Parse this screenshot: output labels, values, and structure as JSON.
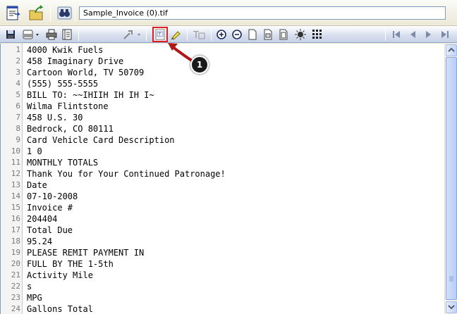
{
  "top_toolbar": {
    "filename": "Sample_Invoice (0).tif",
    "buttons": [
      {
        "name": "document-view-icon"
      },
      {
        "name": "open-folder-icon"
      },
      {
        "name": "binoculars-icon"
      }
    ]
  },
  "toolbar": {
    "icons": [
      "save-icon",
      "print-dropdown-icon",
      "printer-icon",
      "book-icon",
      "tools-dropdown-icon",
      "text-view-icon",
      "highlighter-icon",
      "text-format-icon",
      "zoom-in-icon",
      "zoom-out-icon",
      "page-icon",
      "page-alt-icon",
      "fit-page-icon",
      "brightness-icon",
      "grid-view-icon",
      "first-page-icon",
      "previous-page-icon",
      "next-page-icon",
      "last-page-icon"
    ]
  },
  "callout": {
    "number": "1"
  },
  "editor": {
    "lines": [
      {
        "num": "1",
        "text": "4000 Kwik Fuels"
      },
      {
        "num": "2",
        "text": "458 Imaginary Drive"
      },
      {
        "num": "3",
        "text": "Cartoon World, TV 50709"
      },
      {
        "num": "4",
        "text": "(555) 555-5555"
      },
      {
        "num": "5",
        "text": "BILL TO: ~~IHIIH IH IH I~"
      },
      {
        "num": "6",
        "text": "Wilma Flintstone"
      },
      {
        "num": "7",
        "text": "458 U.S. 30"
      },
      {
        "num": "8",
        "text": "Bedrock, CO 80111"
      },
      {
        "num": "9",
        "text": "Card Vehicle Card Description"
      },
      {
        "num": "10",
        "text": "1 0"
      },
      {
        "num": "11",
        "text": "MONTHLY TOTALS"
      },
      {
        "num": "12",
        "text": "Thank You for Your Continued Patronage!"
      },
      {
        "num": "13",
        "text": "Date"
      },
      {
        "num": "14",
        "text": "07-10-2008"
      },
      {
        "num": "15",
        "text": "Invoice #"
      },
      {
        "num": "16",
        "text": "204404"
      },
      {
        "num": "17",
        "text": "Total Due"
      },
      {
        "num": "18",
        "text": "95.24"
      },
      {
        "num": "19",
        "text": "PLEASE REMIT PAYMENT IN"
      },
      {
        "num": "20",
        "text": "FULL BY THE 1-5th"
      },
      {
        "num": "21",
        "text": "Activity Mile"
      },
      {
        "num": "22",
        "text": "s"
      },
      {
        "num": "23",
        "text": "MPG"
      },
      {
        "num": "24",
        "text": "Gallons Total"
      }
    ]
  },
  "colors": {
    "highlight": "#e02020",
    "arrow": "#b01818"
  }
}
